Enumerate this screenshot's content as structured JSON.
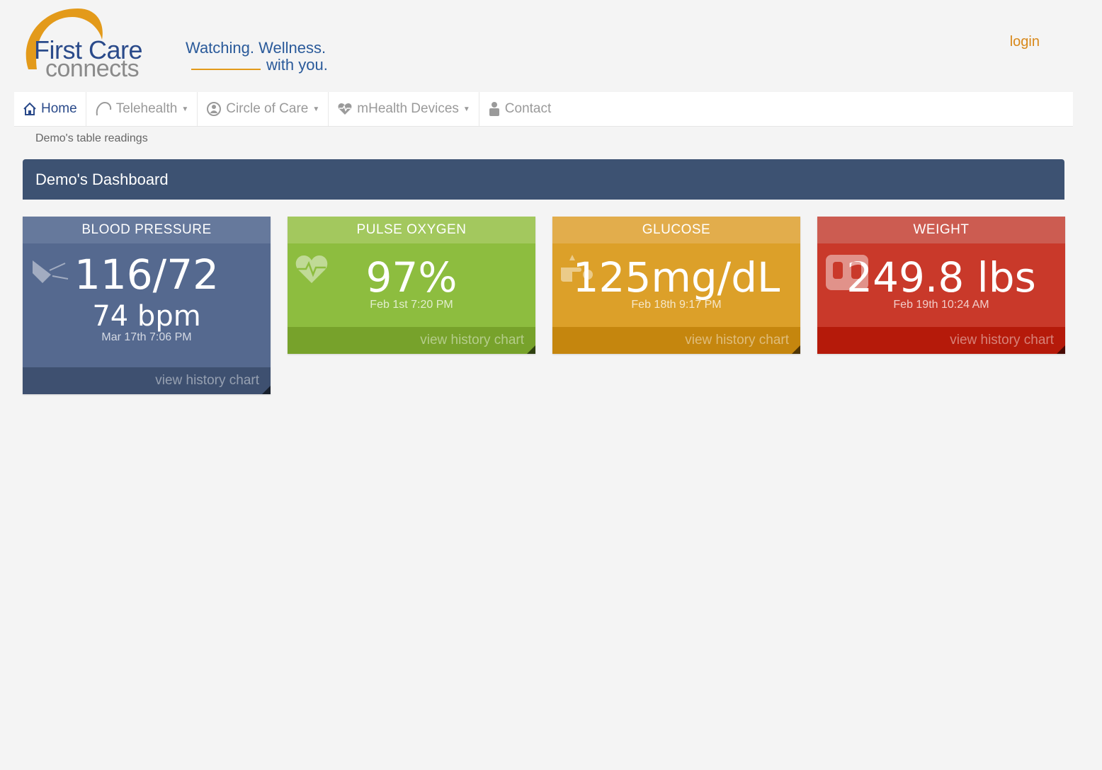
{
  "logo": {
    "line1": "First Care",
    "line2": "connects",
    "accent_color": "#e39a1a",
    "brand_color": "#2a4a8a"
  },
  "tagline": {
    "line1": "Watching. Wellness.",
    "line2": "with you."
  },
  "header": {
    "login_label": "login"
  },
  "nav": {
    "items": [
      {
        "label": "Home",
        "icon": "home-icon",
        "active": true
      },
      {
        "label": "Telehealth",
        "icon": "telehealth-icon",
        "dropdown": true
      },
      {
        "label": "Circle of Care",
        "icon": "circle-of-care-icon",
        "dropdown": true
      },
      {
        "label": "mHealth Devices",
        "icon": "heart-device-icon",
        "dropdown": true
      },
      {
        "label": "Contact",
        "icon": "contact-icon"
      }
    ]
  },
  "breadcrumb": "Demo's table readings",
  "dashboard": {
    "title": "Demo's Dashboard",
    "cards": {
      "blood_pressure": {
        "title": "BLOOD PRESSURE",
        "value": "116/72",
        "pulse": "74 bpm",
        "timestamp": "Mar 17th 7:06 PM",
        "link": "view history chart",
        "icon": "blood-pressure-cuff-icon",
        "color": "#55698f"
      },
      "pulse_oxygen": {
        "title": "PULSE OXYGEN",
        "value": "97%",
        "timestamp": "Feb 1st 7:20 PM",
        "link": "view history chart",
        "icon": "heart-pulse-icon",
        "color": "#8dbd3f"
      },
      "glucose": {
        "title": "GLUCOSE",
        "value": "125mg/dL",
        "timestamp": "Feb 18th 9:17 PM",
        "link": "view history chart",
        "icon": "finger-drop-icon",
        "color": "#dca029"
      },
      "weight": {
        "title": "WEIGHT",
        "value": "249.8 lbs",
        "timestamp": "Feb 19th 10:24 AM",
        "link": "view history chart",
        "icon": "scale-icon",
        "color": "#c9392a"
      }
    }
  }
}
